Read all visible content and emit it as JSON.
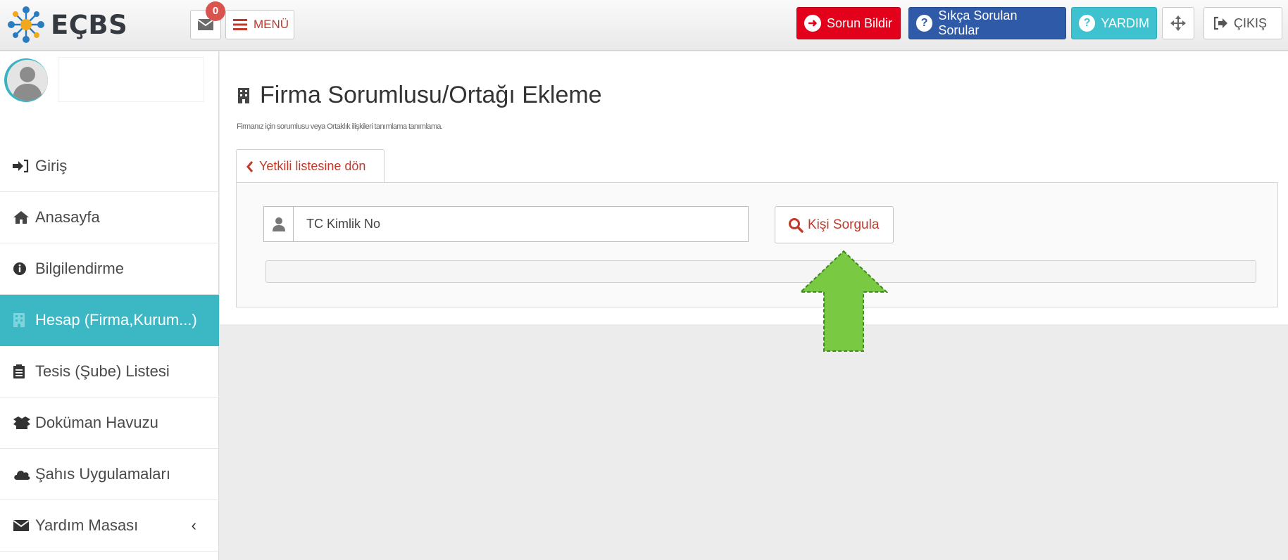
{
  "header": {
    "logo_text": "EÇBS",
    "message_count": "0",
    "menu_label": "MENÜ",
    "report_problem_label": "Sorun Bildir",
    "faq_label": "Sıkça Sorulan Sorular",
    "help_label": "YARDIM",
    "logout_label": "ÇIKIŞ"
  },
  "sidebar": {
    "items": [
      {
        "label": "Giriş",
        "icon": "sign-in-icon"
      },
      {
        "label": "Anasayfa",
        "icon": "home-icon"
      },
      {
        "label": "Bilgilendirme",
        "icon": "info-circle-icon"
      },
      {
        "label": "Hesap (Firma,Kurum...)",
        "icon": "building-icon",
        "active": true
      },
      {
        "label": "Tesis (Şube) Listesi",
        "icon": "clipboard-icon"
      },
      {
        "label": "Doküman Havuzu",
        "icon": "folder-open-icon"
      },
      {
        "label": "Şahıs Uygulamaları",
        "icon": "cloud-icon"
      },
      {
        "label": "Yardım Masası",
        "icon": "envelope-icon"
      }
    ]
  },
  "main": {
    "title": "Firma Sorumlusu/Ortağı Ekleme",
    "subtitle": "Firmanız için sorumlusu veya Ortaklık ilişkileri tanımlama tanımlama.",
    "back_label": "Yetkili listesine dön",
    "tc_placeholder": "TC Kimlik No",
    "query_label": "Kişi Sorgula"
  },
  "colors": {
    "accent": "#3bb8c4",
    "danger": "#e3001b",
    "primary": "#2f5aa8",
    "link_red": "#c0392b",
    "arrow_green": "#7ac943"
  }
}
